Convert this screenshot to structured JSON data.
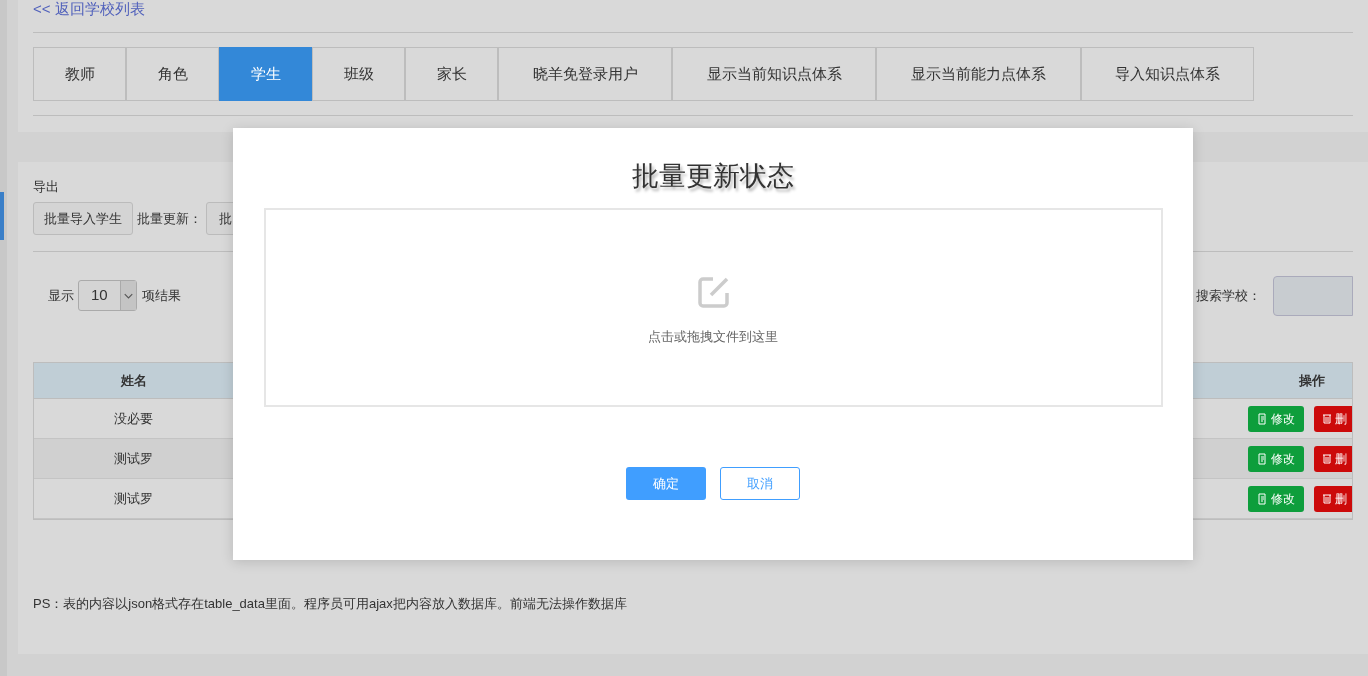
{
  "back_link": "<< 返回学校列表",
  "tabs": [
    {
      "label": "教师",
      "selected": false
    },
    {
      "label": "角色",
      "selected": false
    },
    {
      "label": "学生",
      "selected": true
    },
    {
      "label": "班级",
      "selected": false
    },
    {
      "label": "家长",
      "selected": false
    },
    {
      "label": "晓羊免登录用户",
      "selected": false
    },
    {
      "label": "显示当前知识点体系",
      "selected": false
    },
    {
      "label": "显示当前能力点体系",
      "selected": false
    },
    {
      "label": "导入知识点体系",
      "selected": false
    }
  ],
  "export_label": "导出",
  "toolbar": {
    "import_button": "批量导入学生",
    "update_label": "批量更新：",
    "update_button": "批"
  },
  "page_size": {
    "prefix": "显示",
    "value": "10",
    "suffix": "项结果"
  },
  "search": {
    "label": "搜索学校："
  },
  "table": {
    "columns": [
      "姓名",
      "操作"
    ],
    "rows": [
      {
        "name": "没必要",
        "edit": "修改",
        "delete": "删"
      },
      {
        "name": "测试罗",
        "edit": "修改",
        "delete": "删"
      },
      {
        "name": "测试罗",
        "edit": "修改",
        "delete": "删"
      }
    ]
  },
  "note": "PS：表的内容以json格式存在table_data里面。程序员可用ajax把内容放入数据库。前端无法操作数据库",
  "dialog": {
    "title": "批量更新状态",
    "drop_hint": "点击或拖拽文件到这里",
    "confirm": "确定",
    "cancel": "取消"
  }
}
